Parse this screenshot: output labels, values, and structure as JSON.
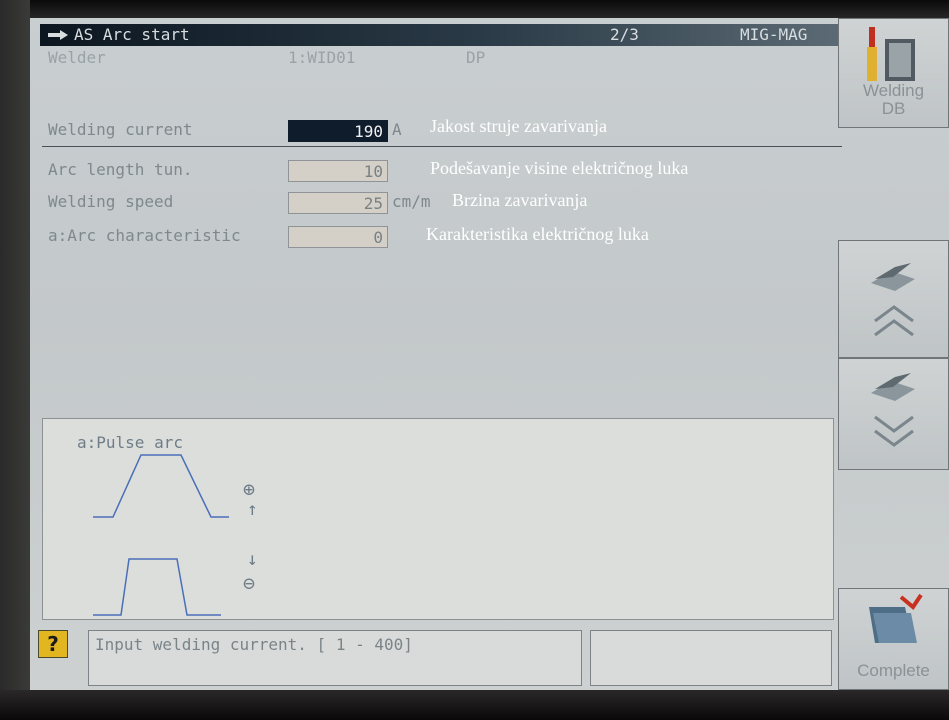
{
  "header": {
    "title": "AS Arc start",
    "page": "2/3",
    "mode": "MIG-MAG"
  },
  "welder": {
    "label": "Welder",
    "id": "1:WID01",
    "type": "DP"
  },
  "params": [
    {
      "label": "Welding current",
      "value": "190",
      "unit": "A",
      "annotation": "Jakost struje zavarivanja"
    },
    {
      "label": "Arc length tun.",
      "value": "10",
      "unit": "",
      "annotation": "Podešavanje visine električnog luka"
    },
    {
      "label": "Welding speed",
      "value": "25",
      "unit": "cm/m",
      "annotation": "Brzina zavarivanja"
    },
    {
      "label": "a:Arc characteristic",
      "value": "0",
      "unit": "",
      "annotation": "Karakteristika električnog luka"
    }
  ],
  "diagram": {
    "title": "a:Pulse arc",
    "plus": "⊕",
    "minus": "⊖",
    "up": "↑",
    "down": "↓"
  },
  "status": {
    "help_icon": "?",
    "message": "Input welding current.  [  1 - 400]"
  },
  "sidebar": {
    "db_label_1": "Welding",
    "db_label_2": "DB",
    "complete_label": "Complete"
  },
  "colors": {
    "active_field": "#0f1c2c",
    "help_icon": "#e2b620"
  }
}
